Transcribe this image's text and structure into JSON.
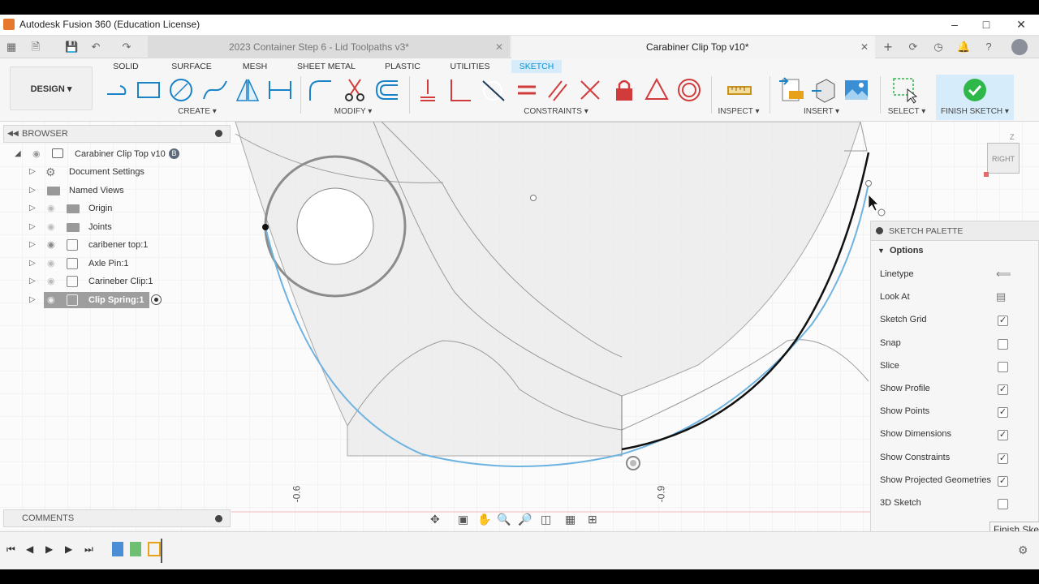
{
  "app": {
    "title": "Autodesk Fusion 360 (Education License)"
  },
  "tabs": [
    {
      "label": "2023 Container Step 6 - Lid Toolpaths v3*"
    },
    {
      "label": "Carabiner Clip Top v10*"
    }
  ],
  "workspace": {
    "label": "DESIGN ▾"
  },
  "toolbar_tabs": [
    "SOLID",
    "SURFACE",
    "MESH",
    "SHEET METAL",
    "PLASTIC",
    "UTILITIES",
    "SKETCH"
  ],
  "groups": {
    "create": "CREATE ▾",
    "modify": "MODIFY ▾",
    "constraints": "CONSTRAINTS ▾",
    "inspect": "INSPECT ▾",
    "insert": "INSERT ▾",
    "select": "SELECT ▾",
    "finish": "FINISH SKETCH ▾"
  },
  "browser": {
    "header": "BROWSER",
    "root": "Carabiner Clip Top v10",
    "items": [
      {
        "label": "Document Settings",
        "icon": "gear-icon"
      },
      {
        "label": "Named Views",
        "icon": "folder-icon"
      },
      {
        "label": "Origin",
        "icon": "folder-icon"
      },
      {
        "label": "Joints",
        "icon": "folder-icon"
      },
      {
        "label": "caribener top:1",
        "icon": "component-icon"
      },
      {
        "label": "Axle Pin:1",
        "icon": "component-icon"
      },
      {
        "label": "Carineber Clip:1",
        "icon": "component-icon"
      },
      {
        "label": "Clip Spring:1",
        "icon": "component-icon"
      }
    ]
  },
  "comments": {
    "header": "COMMENTS"
  },
  "viewcube": {
    "face": "RIGHT",
    "axis": "Z"
  },
  "axis_labels": {
    "left": "-0.6",
    "right": "-0.9"
  },
  "palette": {
    "header": "SKETCH PALETTE",
    "section": "Options",
    "rows": [
      {
        "label": "Linetype",
        "kind": "icon"
      },
      {
        "label": "Look At",
        "kind": "icon"
      },
      {
        "label": "Sketch Grid",
        "kind": "check",
        "checked": true
      },
      {
        "label": "Snap",
        "kind": "check",
        "checked": false
      },
      {
        "label": "Slice",
        "kind": "check",
        "checked": false
      },
      {
        "label": "Show Profile",
        "kind": "check",
        "checked": true
      },
      {
        "label": "Show Points",
        "kind": "check",
        "checked": true
      },
      {
        "label": "Show Dimensions",
        "kind": "check",
        "checked": true
      },
      {
        "label": "Show Constraints",
        "kind": "check",
        "checked": true
      },
      {
        "label": "Show Projected Geometries",
        "kind": "check",
        "checked": true
      },
      {
        "label": "3D Sketch",
        "kind": "check",
        "checked": false
      }
    ],
    "finish_button": "Finish Sketch"
  },
  "colors": {
    "accent": "#0696d7",
    "finish_green": "#2fb84a",
    "active_tab_bg": "#d6ecfb"
  }
}
